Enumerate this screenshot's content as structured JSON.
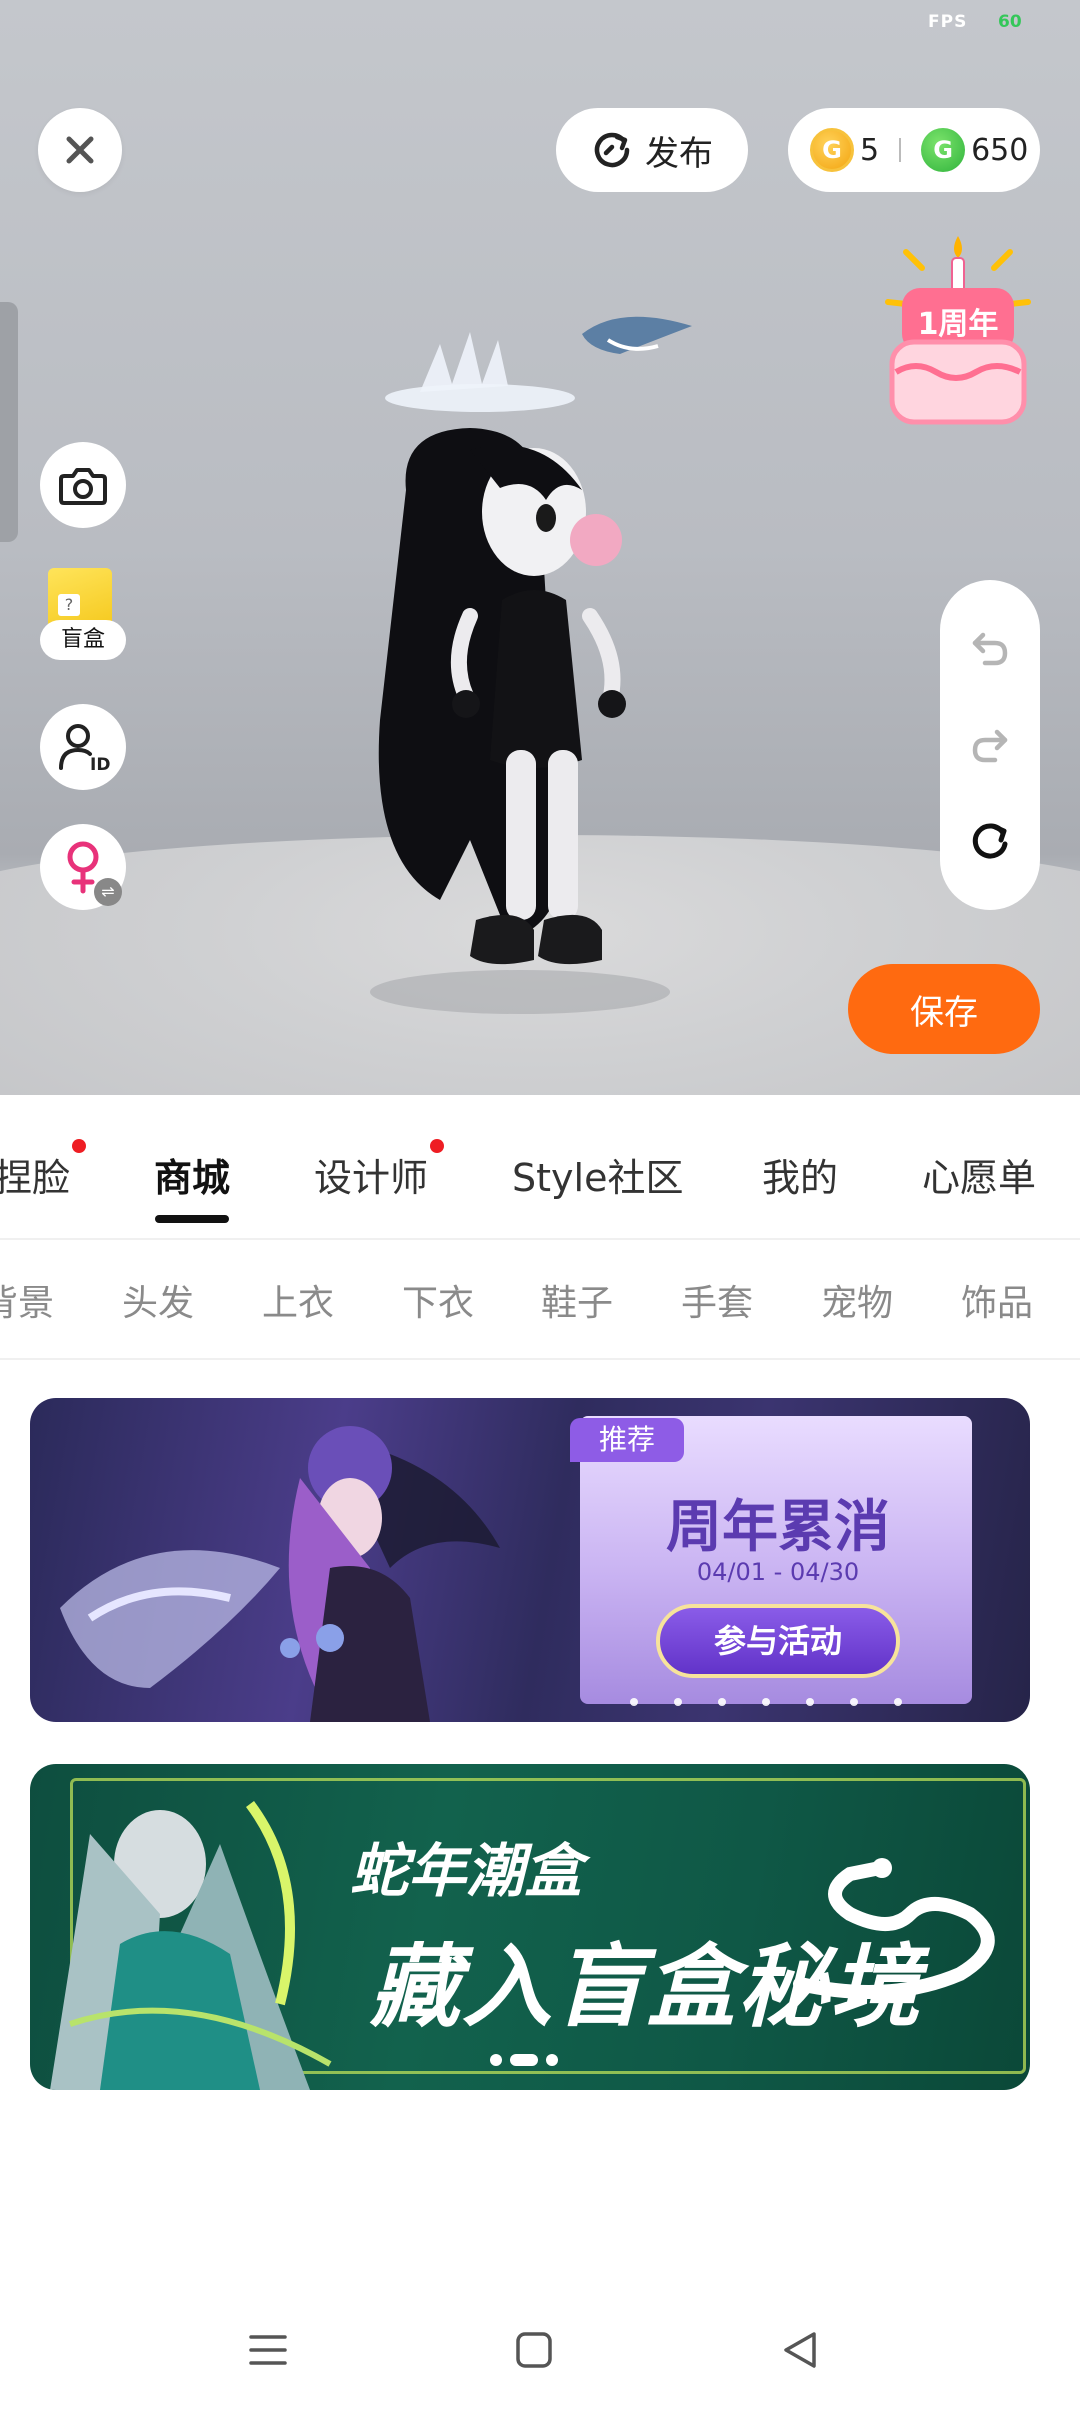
{
  "status": {
    "fps_label": "FPS",
    "fps_value": "60"
  },
  "header": {
    "publish_label": "发布",
    "coins": {
      "gold": "5",
      "green": "650",
      "gold_icon_letter": "G",
      "green_icon_letter": "G"
    }
  },
  "side": {
    "blindbox_label": "盲盒",
    "id_badge": "ID",
    "gender_swap": "⇌",
    "blindbox_q": "?"
  },
  "anniversary": {
    "label": "1周年"
  },
  "actions": {
    "save_label": "保存"
  },
  "tabs": [
    {
      "label": "捏脸",
      "dot": true
    },
    {
      "label": "商城",
      "active": true
    },
    {
      "label": "设计师",
      "dot": true
    },
    {
      "label": "Style社区"
    },
    {
      "label": "我的"
    },
    {
      "label": "心愿单"
    }
  ],
  "categories": [
    "背景",
    "头发",
    "上衣",
    "下衣",
    "鞋子",
    "手套",
    "宠物",
    "饰品"
  ],
  "banner1": {
    "tag": "推荐",
    "title": "周年累消",
    "date": "04/01 - 04/30",
    "cta": "参与活动"
  },
  "banner2": {
    "line1": "蛇年潮盒",
    "line2": "藏入盲盒秘境"
  },
  "icons": {
    "close": "close-icon",
    "publish": "refresh-arrow-icon",
    "camera": "camera-icon",
    "id": "user-id-icon",
    "gender": "female-icon",
    "undo": "undo-icon",
    "redo": "redo-icon",
    "reset": "reset-icon",
    "nav_menu": "menu-icon",
    "nav_home": "home-icon",
    "nav_back": "back-icon"
  },
  "colors": {
    "accent": "#ff6a10",
    "tab_dot": "#ee1d23",
    "gold": "#f3a410",
    "green": "#2fb33c"
  }
}
